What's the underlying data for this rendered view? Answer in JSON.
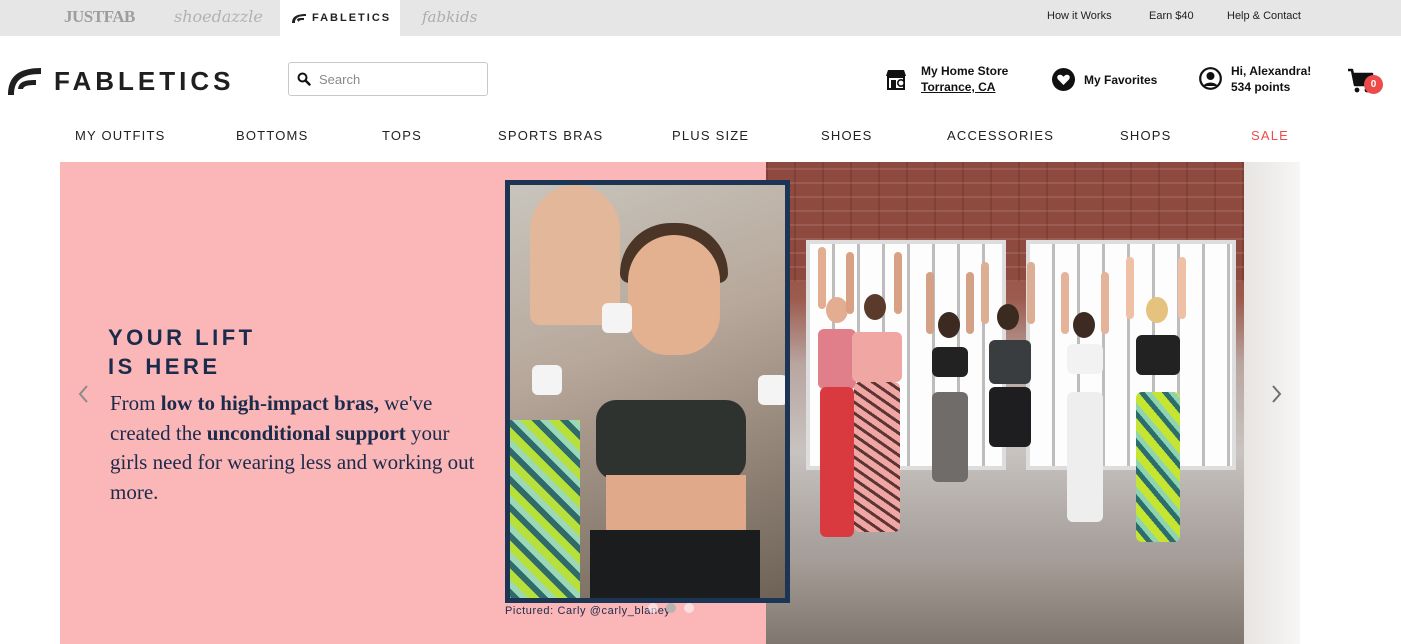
{
  "brand_bar": {
    "tabs": [
      {
        "label": "JUSTFAB"
      },
      {
        "label": "shoedazzle"
      },
      {
        "label": "FABLETICS"
      },
      {
        "label": "fabkids"
      }
    ],
    "active_tab": "FABLETICS",
    "links": {
      "how_it_works": "How it Works",
      "earn": "Earn $40",
      "help": "Help & Contact"
    }
  },
  "header": {
    "logo_text": "FABLETICS",
    "search": {
      "placeholder": "Search",
      "value": ""
    },
    "store": {
      "label": "My Home Store",
      "location": "Torrance, CA"
    },
    "favorites_label": "My Favorites",
    "account": {
      "greeting": "Hi, Alexandra!",
      "points": "534 points"
    },
    "cart_count": "0"
  },
  "nav": {
    "items": [
      {
        "label": "MY OUTFITS"
      },
      {
        "label": "BOTTOMS"
      },
      {
        "label": "TOPS"
      },
      {
        "label": "SPORTS BRAS"
      },
      {
        "label": "PLUS SIZE"
      },
      {
        "label": "SHOES"
      },
      {
        "label": "ACCESSORIES"
      },
      {
        "label": "SHOPS"
      },
      {
        "label": "SALE"
      }
    ]
  },
  "hero": {
    "title": "YOUR LIFT\nIS HERE",
    "body": {
      "p1": "From ",
      "b1": "low to high-impact bras,",
      "p2": " we've created the ",
      "b2": "unconditional support",
      "p3": " your girls need for wearing less and working out more."
    },
    "caption": "Pictured: Carly @carly_blaney",
    "slides": 3,
    "active_slide": 2
  },
  "colors": {
    "hero_bg": "#fbb6b7",
    "navy": "#1b2b4b",
    "sale_red": "#ef4a4a",
    "cart_badge": "#ef4a4a",
    "brand_bar": "#e6e6e6"
  },
  "icons": [
    "fabletics-logo-icon",
    "search-icon",
    "store-icon",
    "heart-icon",
    "user-icon",
    "cart-icon",
    "chevron-left-icon",
    "chevron-right-icon"
  ]
}
